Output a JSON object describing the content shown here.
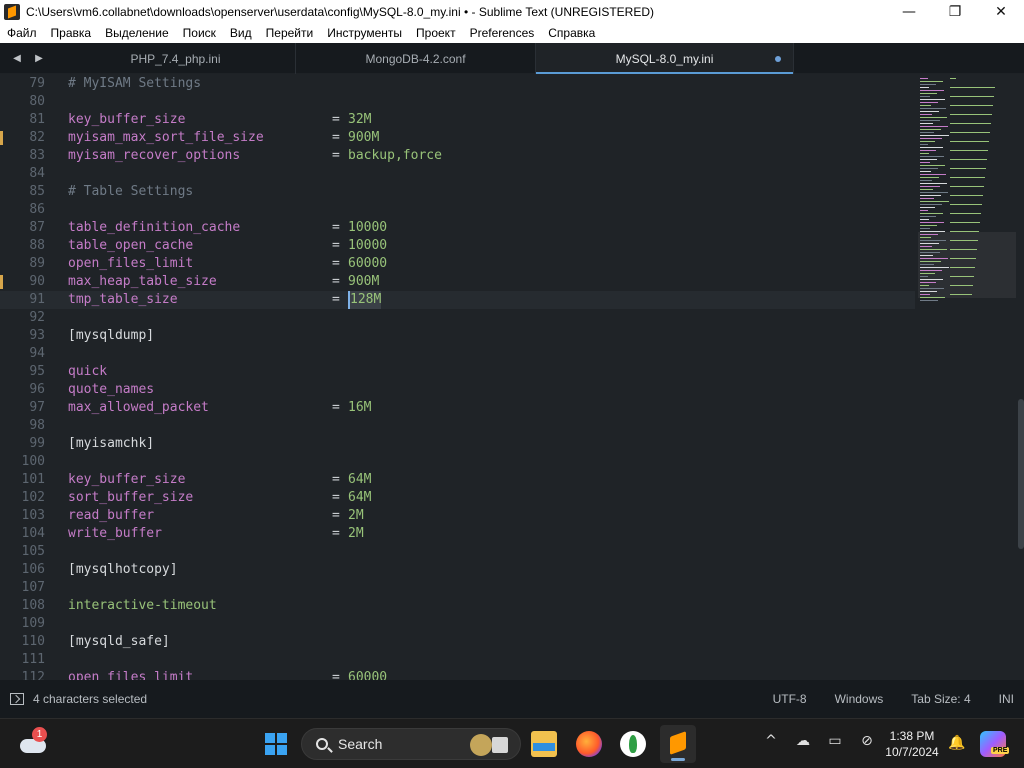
{
  "window": {
    "title": "C:\\Users\\vm6.collabnet\\downloads\\openserver\\userdata\\config\\MySQL-8.0_my.ini • - Sublime Text (UNREGISTERED)",
    "minimize_glyph": "—",
    "maximize_glyph": "❐",
    "close_glyph": "✕"
  },
  "menu": [
    "Файл",
    "Правка",
    "Выделение",
    "Поиск",
    "Вид",
    "Перейти",
    "Инструменты",
    "Проект",
    "Preferences",
    "Справка"
  ],
  "tabs": {
    "nav_left": "◀",
    "nav_right": "▶",
    "items": [
      {
        "label": "PHP_7.4_php.ini",
        "active": false
      },
      {
        "label": "MongoDB-4.2.conf",
        "active": false
      },
      {
        "label": "MySQL-8.0_my.ini",
        "active": true,
        "dirty": true
      }
    ]
  },
  "editor": {
    "lines": [
      {
        "num": "79",
        "type": "comment",
        "text": "# MyISAM Settings"
      },
      {
        "num": "80",
        "type": "blank"
      },
      {
        "num": "81",
        "type": "kv",
        "key": "key_buffer_size",
        "eq": "=",
        "val": "32M"
      },
      {
        "num": "82",
        "type": "kv",
        "key": "myisam_max_sort_file_size",
        "eq": "=",
        "val": "900M",
        "modified": true
      },
      {
        "num": "83",
        "type": "kv",
        "key": "myisam_recover_options",
        "eq": "=",
        "val": "backup,force"
      },
      {
        "num": "84",
        "type": "blank"
      },
      {
        "num": "85",
        "type": "comment",
        "text": "# Table Settings"
      },
      {
        "num": "86",
        "type": "blank"
      },
      {
        "num": "87",
        "type": "kv",
        "key": "table_definition_cache",
        "eq": "=",
        "val": "10000"
      },
      {
        "num": "88",
        "type": "kv",
        "key": "table_open_cache",
        "eq": "=",
        "val": "10000"
      },
      {
        "num": "89",
        "type": "kv",
        "key": "open_files_limit",
        "eq": "=",
        "val": "60000"
      },
      {
        "num": "90",
        "type": "kv",
        "key": "max_heap_table_size",
        "eq": "=",
        "val": "900M",
        "modified": true
      },
      {
        "num": "91",
        "type": "kv",
        "key": "tmp_table_size",
        "eq": "=",
        "val": "128M",
        "caret": true,
        "selected": true
      },
      {
        "num": "92",
        "type": "blank"
      },
      {
        "num": "93",
        "type": "section",
        "text": "[mysqldump]"
      },
      {
        "num": "94",
        "type": "blank"
      },
      {
        "num": "95",
        "type": "key",
        "text": "quick"
      },
      {
        "num": "96",
        "type": "key",
        "text": "quote_names"
      },
      {
        "num": "97",
        "type": "kv",
        "key": "max_allowed_packet",
        "eq": "=",
        "val": "16M"
      },
      {
        "num": "98",
        "type": "blank"
      },
      {
        "num": "99",
        "type": "section",
        "text": "[myisamchk]"
      },
      {
        "num": "100",
        "type": "blank"
      },
      {
        "num": "101",
        "type": "kv",
        "key": "key_buffer_size",
        "eq": "=",
        "val": "64M"
      },
      {
        "num": "102",
        "type": "kv",
        "key": "sort_buffer_size",
        "eq": "=",
        "val": "64M"
      },
      {
        "num": "103",
        "type": "kv",
        "key": "read_buffer",
        "eq": "=",
        "val": "2M"
      },
      {
        "num": "104",
        "type": "kv",
        "key": "write_buffer",
        "eq": "=",
        "val": "2M"
      },
      {
        "num": "105",
        "type": "blank"
      },
      {
        "num": "106",
        "type": "section",
        "text": "[mysqlhotcopy]"
      },
      {
        "num": "107",
        "type": "blank"
      },
      {
        "num": "108",
        "type": "key-green",
        "text": "interactive-timeout"
      },
      {
        "num": "109",
        "type": "blank"
      },
      {
        "num": "110",
        "type": "section",
        "text": "[mysqld_safe]"
      },
      {
        "num": "111",
        "type": "blank"
      },
      {
        "num": "112",
        "type": "kv",
        "key": "open_files_limit",
        "eq": "=",
        "val": "60000"
      }
    ]
  },
  "status": {
    "selection": "4 characters selected",
    "encoding": "UTF-8",
    "line_endings": "Windows",
    "indent": "Tab Size: 4",
    "syntax": "INI"
  },
  "taskbar": {
    "weather_badge": "1",
    "search_label": "Search",
    "time": "1:38 PM",
    "date": "10/7/2024",
    "copilot_badge": "PRE",
    "tray_glyphs": [
      "^",
      "☁",
      "▭",
      "⊘"
    ],
    "bell_glyph": "🔔"
  },
  "colors": {
    "editor_bg": "#1f2327",
    "key": "#c57cc8",
    "value": "#98c379",
    "comment": "#6f7a86",
    "tab_accent": "#5a9bd5"
  }
}
